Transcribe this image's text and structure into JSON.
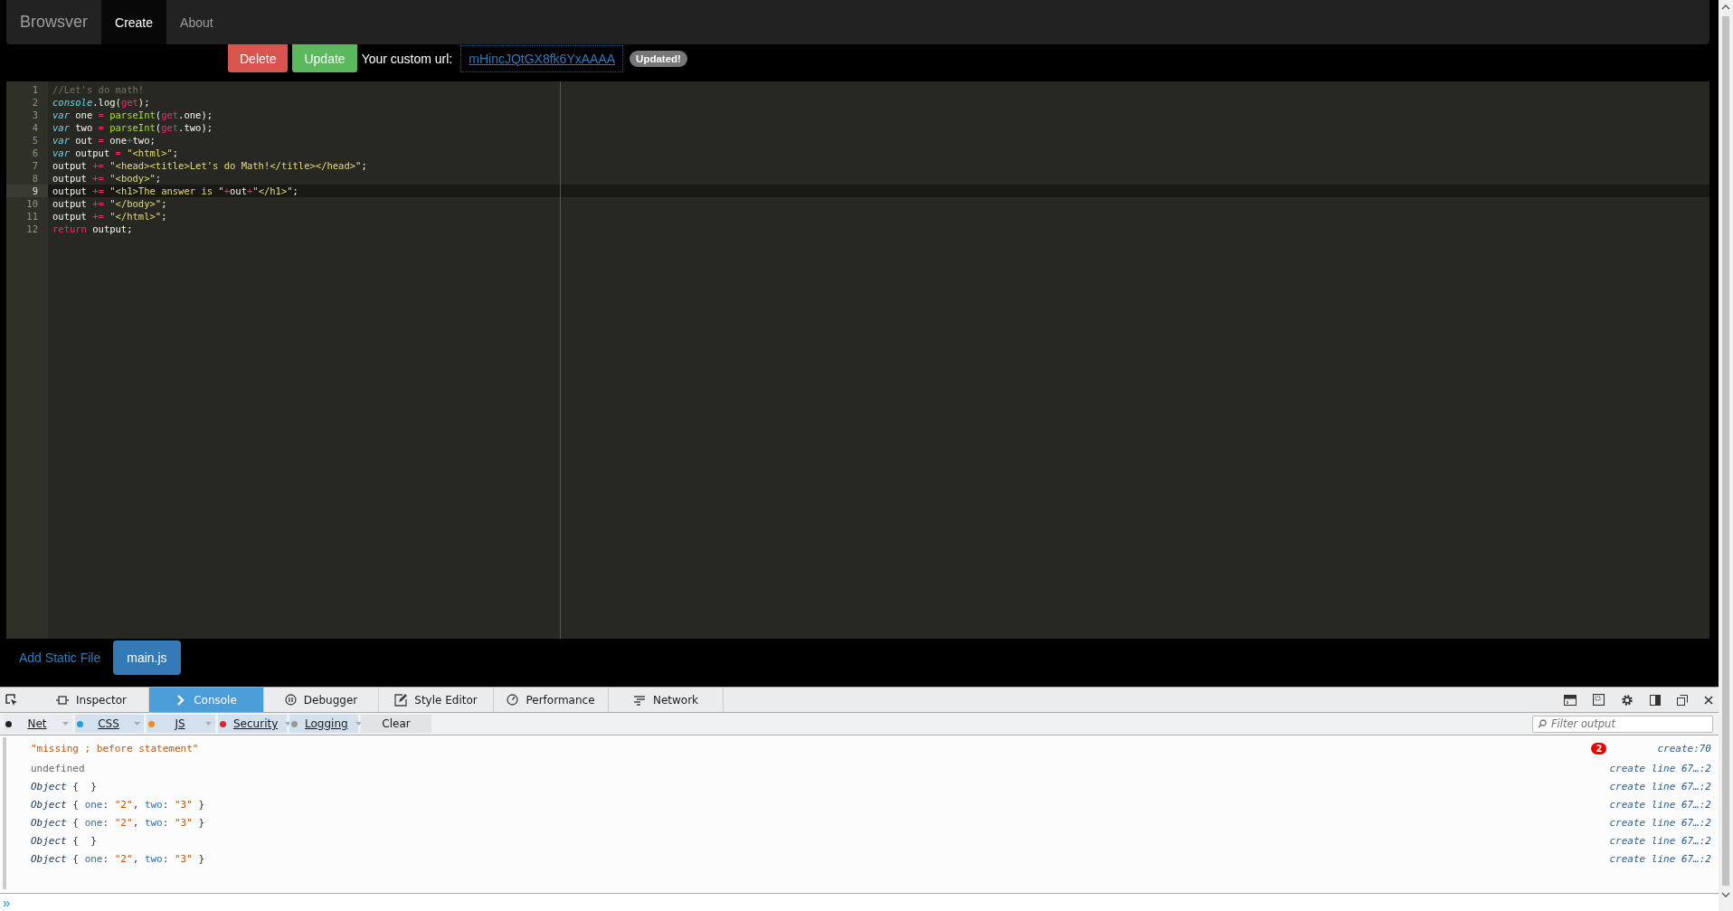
{
  "navbar": {
    "brand": "Browsver",
    "items": [
      {
        "label": "Create",
        "selected": true
      },
      {
        "label": "About",
        "selected": false
      }
    ]
  },
  "actions": {
    "buttons": [
      {
        "label": "Delete",
        "kind": "danger"
      },
      {
        "label": "Update",
        "kind": "success"
      }
    ],
    "url_label": "Your custom url:",
    "url": "mHincJQtGX8fk6YxAAAA",
    "status_badge": "Updated!"
  },
  "editor": {
    "lines": [
      {
        "number": "1",
        "active": false,
        "tokens": [
          {
            "text": "//Let's do math!",
            "kind": "comment"
          }
        ]
      },
      {
        "number": "2",
        "active": false,
        "tokens": [
          {
            "text": "console",
            "kind": "builtin"
          },
          {
            "text": ".log(",
            "kind": "plain"
          },
          {
            "text": "get",
            "kind": "param"
          },
          {
            "text": ");",
            "kind": "plain"
          }
        ]
      },
      {
        "number": "3",
        "active": false,
        "tokens": [
          {
            "text": "var",
            "kind": "keyword"
          },
          {
            "text": " one ",
            "kind": "plain"
          },
          {
            "text": "=",
            "kind": "op"
          },
          {
            "text": " parseInt",
            "kind": "func"
          },
          {
            "text": "(",
            "kind": "plain"
          },
          {
            "text": "get",
            "kind": "param"
          },
          {
            "text": ".one);",
            "kind": "plain"
          }
        ]
      },
      {
        "number": "4",
        "active": false,
        "tokens": [
          {
            "text": "var",
            "kind": "keyword"
          },
          {
            "text": " two ",
            "kind": "plain"
          },
          {
            "text": "=",
            "kind": "op"
          },
          {
            "text": " parseInt",
            "kind": "func"
          },
          {
            "text": "(",
            "kind": "plain"
          },
          {
            "text": "get",
            "kind": "param"
          },
          {
            "text": ".two);",
            "kind": "plain"
          }
        ]
      },
      {
        "number": "5",
        "active": false,
        "tokens": [
          {
            "text": "var",
            "kind": "keyword"
          },
          {
            "text": " out ",
            "kind": "plain"
          },
          {
            "text": "=",
            "kind": "op"
          },
          {
            "text": " one",
            "kind": "plain"
          },
          {
            "text": "+",
            "kind": "op"
          },
          {
            "text": "two;",
            "kind": "plain"
          }
        ]
      },
      {
        "number": "6",
        "active": false,
        "tokens": [
          {
            "text": "var",
            "kind": "keyword"
          },
          {
            "text": " output ",
            "kind": "plain"
          },
          {
            "text": "=",
            "kind": "op"
          },
          {
            "text": " \"<html>\"",
            "kind": "string"
          },
          {
            "text": ";",
            "kind": "plain"
          }
        ]
      },
      {
        "number": "7",
        "active": false,
        "tokens": [
          {
            "text": "output ",
            "kind": "plain"
          },
          {
            "text": "+=",
            "kind": "op"
          },
          {
            "text": " \"<head><title>Let's do Math!</title></head>\"",
            "kind": "string"
          },
          {
            "text": ";",
            "kind": "plain"
          }
        ]
      },
      {
        "number": "8",
        "active": false,
        "tokens": [
          {
            "text": "output ",
            "kind": "plain"
          },
          {
            "text": "+=",
            "kind": "op"
          },
          {
            "text": " \"<body>\"",
            "kind": "string"
          },
          {
            "text": ";",
            "kind": "plain"
          }
        ]
      },
      {
        "number": "9",
        "active": true,
        "tokens": [
          {
            "text": "output ",
            "kind": "plain"
          },
          {
            "text": "+=",
            "kind": "op"
          },
          {
            "text": " \"<h1>The answer is \"",
            "kind": "string"
          },
          {
            "text": "+",
            "kind": "op"
          },
          {
            "text": "out",
            "kind": "plain"
          },
          {
            "text": "+",
            "kind": "op"
          },
          {
            "text": "\"</h1>\"",
            "kind": "string"
          },
          {
            "text": ";",
            "kind": "plain"
          }
        ]
      },
      {
        "number": "10",
        "active": false,
        "tokens": [
          {
            "text": "output ",
            "kind": "plain"
          },
          {
            "text": "+=",
            "kind": "op"
          },
          {
            "text": " \"</body>\"",
            "kind": "string"
          },
          {
            "text": ";",
            "kind": "plain"
          }
        ]
      },
      {
        "number": "11",
        "active": false,
        "tokens": [
          {
            "text": "output ",
            "kind": "plain"
          },
          {
            "text": "+=",
            "kind": "op"
          },
          {
            "text": " \"</html>\"",
            "kind": "string"
          },
          {
            "text": ";",
            "kind": "plain"
          }
        ]
      },
      {
        "number": "12",
        "active": false,
        "tokens": [
          {
            "text": "return",
            "kind": "op"
          },
          {
            "text": " output;",
            "kind": "plain"
          }
        ]
      }
    ]
  },
  "files": {
    "add_link": "Add Static File",
    "tabs": [
      {
        "label": "main.js",
        "selected": true
      }
    ]
  },
  "devtools": {
    "tabs": [
      {
        "label": "Inspector",
        "selected": false
      },
      {
        "label": "Console",
        "selected": true
      },
      {
        "label": "Debugger",
        "selected": false
      },
      {
        "label": "Style Editor",
        "selected": false
      },
      {
        "label": "Performance",
        "selected": false
      },
      {
        "label": "Network",
        "selected": false
      }
    ],
    "filters": [
      {
        "label": "Net",
        "color": "#222222"
      },
      {
        "label": "CSS",
        "color": "#1ba2e0"
      },
      {
        "label": "JS",
        "color": "#f28a1f"
      },
      {
        "label": "Security",
        "color": "#e0242e"
      },
      {
        "label": "Logging",
        "color": "#9a9a9a"
      }
    ],
    "clear": "Clear",
    "filter_placeholder": "Filter output",
    "messages": [
      {
        "tokens": [
          {
            "text": "\"missing ; before statement\"",
            "kind": "error"
          }
        ],
        "count": "2",
        "source": "create:70"
      },
      {
        "tokens": [
          {
            "text": "undefined",
            "kind": "undef"
          }
        ],
        "source": "create line 67…:2"
      },
      {
        "tokens": [
          {
            "text": "Object",
            "kind": "obj"
          },
          {
            "text": " {  }",
            "kind": "punct"
          }
        ],
        "source": "create line 67…:2"
      },
      {
        "tokens": [
          {
            "text": "Object",
            "kind": "obj"
          },
          {
            "text": " { ",
            "kind": "punct"
          },
          {
            "text": "one",
            "kind": "key"
          },
          {
            "text": ": ",
            "kind": "punct"
          },
          {
            "text": "\"2\"",
            "kind": "str"
          },
          {
            "text": ", ",
            "kind": "punct"
          },
          {
            "text": "two",
            "kind": "key"
          },
          {
            "text": ": ",
            "kind": "punct"
          },
          {
            "text": "\"3\"",
            "kind": "str"
          },
          {
            "text": " }",
            "kind": "punct"
          }
        ],
        "source": "create line 67…:2"
      },
      {
        "tokens": [
          {
            "text": "Object",
            "kind": "obj"
          },
          {
            "text": " { ",
            "kind": "punct"
          },
          {
            "text": "one",
            "kind": "key"
          },
          {
            "text": ": ",
            "kind": "punct"
          },
          {
            "text": "\"2\"",
            "kind": "str"
          },
          {
            "text": ", ",
            "kind": "punct"
          },
          {
            "text": "two",
            "kind": "key"
          },
          {
            "text": ": ",
            "kind": "punct"
          },
          {
            "text": "\"3\"",
            "kind": "str"
          },
          {
            "text": " }",
            "kind": "punct"
          }
        ],
        "source": "create line 67…:2"
      },
      {
        "tokens": [
          {
            "text": "Object",
            "kind": "obj"
          },
          {
            "text": " {  }",
            "kind": "punct"
          }
        ],
        "source": "create line 67…:2"
      },
      {
        "tokens": [
          {
            "text": "Object",
            "kind": "obj"
          },
          {
            "text": " { ",
            "kind": "punct"
          },
          {
            "text": "one",
            "kind": "key"
          },
          {
            "text": ": ",
            "kind": "punct"
          },
          {
            "text": "\"2\"",
            "kind": "str"
          },
          {
            "text": ", ",
            "kind": "punct"
          },
          {
            "text": "two",
            "kind": "key"
          },
          {
            "text": ": ",
            "kind": "punct"
          },
          {
            "text": "\"3\"",
            "kind": "str"
          },
          {
            "text": " }",
            "kind": "punct"
          }
        ],
        "source": "create line 67…:2"
      }
    ],
    "prompt": "»"
  }
}
